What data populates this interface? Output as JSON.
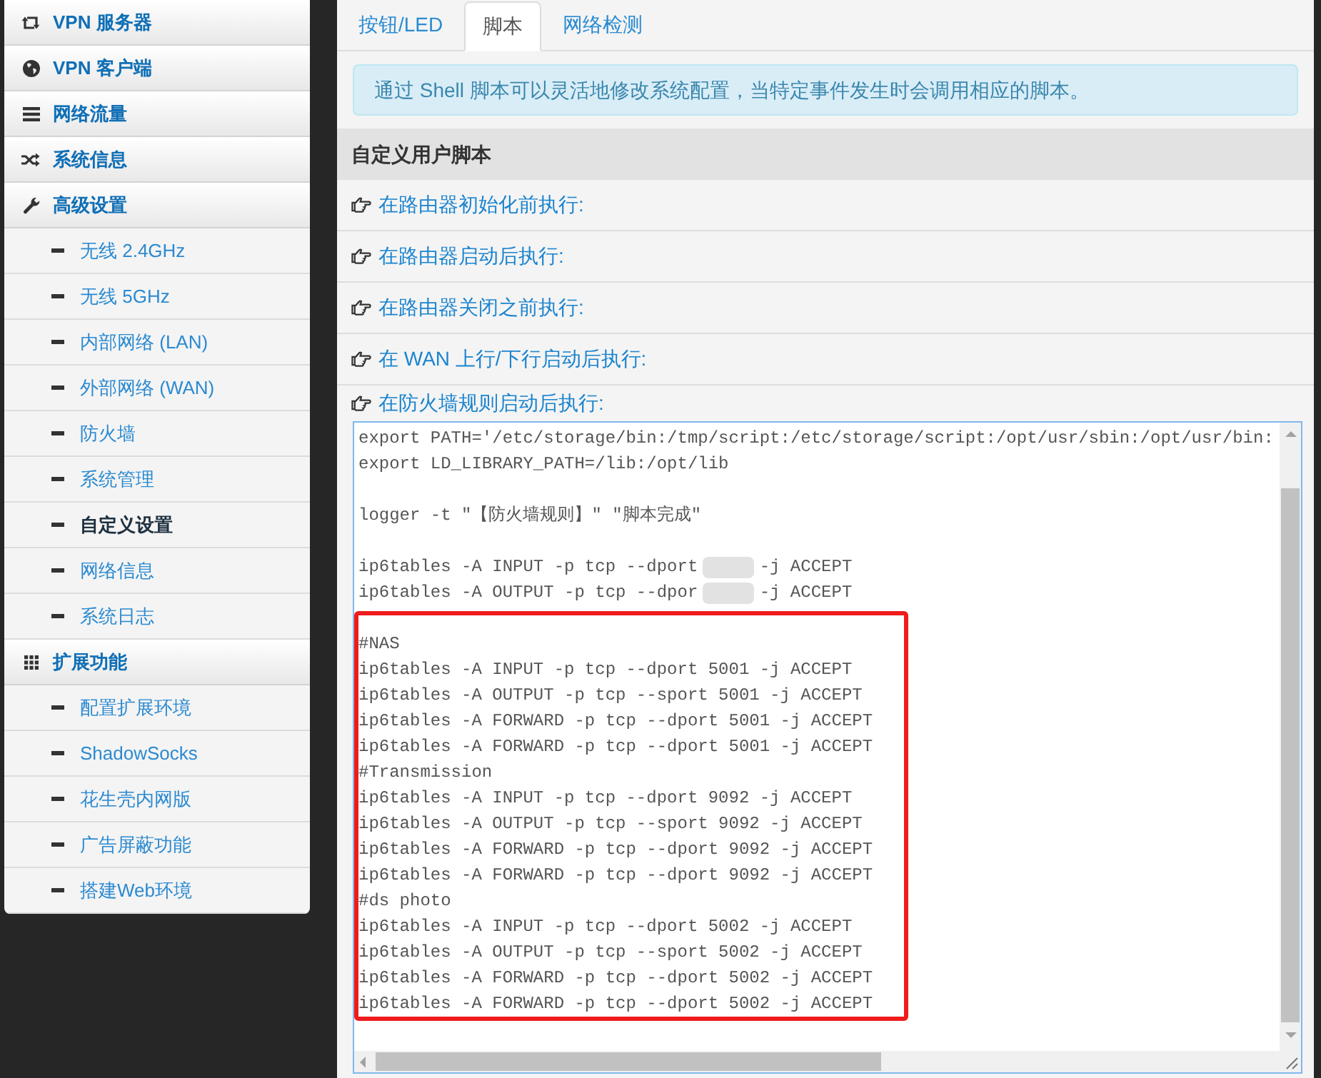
{
  "sidebar": [
    {
      "label": "VPN 服务器"
    },
    {
      "label": "VPN 客户端"
    },
    {
      "label": "网络流量"
    },
    {
      "label": "系统信息"
    },
    {
      "label": "高级设置",
      "children": [
        {
          "label": "无线 2.4GHz",
          "selected": false
        },
        {
          "label": "无线 5GHz",
          "selected": false
        },
        {
          "label": "内部网络 (LAN)",
          "selected": false
        },
        {
          "label": "外部网络 (WAN)",
          "selected": false
        },
        {
          "label": "防火墙",
          "selected": false
        },
        {
          "label": "系统管理",
          "selected": false
        },
        {
          "label": "自定义设置",
          "selected": true
        },
        {
          "label": "网络信息",
          "selected": false
        },
        {
          "label": "系统日志",
          "selected": false
        }
      ]
    },
    {
      "label": "扩展功能",
      "children": [
        {
          "label": "配置扩展环境",
          "selected": false
        },
        {
          "label": "ShadowSocks",
          "selected": false
        },
        {
          "label": "花生壳内网版",
          "selected": false
        },
        {
          "label": "广告屏蔽功能",
          "selected": false
        },
        {
          "label": "搭建Web环境",
          "selected": false
        }
      ]
    }
  ],
  "tabs": [
    {
      "label": "按钮/LED",
      "selected": false
    },
    {
      "label": "脚本",
      "selected": true
    },
    {
      "label": "网络检测",
      "selected": false
    }
  ],
  "alert": {
    "text": "通过 Shell 脚本可以灵活地修改系统配置，当特定事件发生时会调用相应的脚本。"
  },
  "section": {
    "title": "自定义用户脚本",
    "scripts": [
      {
        "label": "在路由器初始化前执行:",
        "expanded": false
      },
      {
        "label": "在路由器启动后执行:",
        "expanded": false
      },
      {
        "label": "在路由器关闭之前执行:",
        "expanded": false
      },
      {
        "label": "在 WAN 上行/下行启动后执行:",
        "expanded": false
      },
      {
        "label": "在防火墙规则启动后执行:",
        "expanded": true,
        "editor": {
          "lines": [
            {
              "kind": "code",
              "text": "export PATH='/etc/storage/bin:/tmp/script:/etc/storage/script:/opt/usr/sbin:/opt/usr/bin:"
            },
            {
              "kind": "code",
              "text": "export LD_LIBRARY_PATH=/lib:/opt/lib"
            },
            {
              "kind": "blank"
            },
            {
              "kind": "code",
              "text": "logger -t \"【防火墙规则】\" \"脚本完成\""
            },
            {
              "kind": "blank"
            },
            {
              "kind": "redacted",
              "before": "ip6tables -A INPUT -p tcp --dport",
              "after": "-j ACCEPT"
            },
            {
              "kind": "redacted",
              "before": "ip6tables -A OUTPUT -p tcp --dpor",
              "after": "-j ACCEPT"
            }
          ],
          "highlighted_lines": [
            {
              "kind": "code",
              "text": "#NAS"
            },
            {
              "kind": "code",
              "text": "ip6tables -A INPUT -p tcp --dport 5001 -j ACCEPT"
            },
            {
              "kind": "code",
              "text": "ip6tables -A OUTPUT -p tcp --sport 5001 -j ACCEPT"
            },
            {
              "kind": "code",
              "text": "ip6tables -A FORWARD -p tcp --dport 5001 -j ACCEPT"
            },
            {
              "kind": "code",
              "text": "ip6tables -A FORWARD -p tcp --dport 5001 -j ACCEPT"
            },
            {
              "kind": "code",
              "text": "#Transmission"
            },
            {
              "kind": "code",
              "text": "ip6tables -A INPUT -p tcp --dport 9092 -j ACCEPT"
            },
            {
              "kind": "code",
              "text": "ip6tables -A OUTPUT -p tcp --sport 9092 -j ACCEPT"
            },
            {
              "kind": "code",
              "text": "ip6tables -A FORWARD -p tcp --dport 9092 -j ACCEPT"
            },
            {
              "kind": "code",
              "text": "ip6tables -A FORWARD -p tcp --dport 9092 -j ACCEPT"
            },
            {
              "kind": "code",
              "text": "#ds photo"
            },
            {
              "kind": "code",
              "text": "ip6tables -A INPUT -p tcp --dport 5002 -j ACCEPT"
            },
            {
              "kind": "code",
              "text": "ip6tables -A OUTPUT -p tcp --sport 5002 -j ACCEPT"
            },
            {
              "kind": "code",
              "text": "ip6tables -A FORWARD -p tcp --dport 5002 -j ACCEPT"
            },
            {
              "kind": "code",
              "text": "ip6tables -A FORWARD -p tcp --dport 5002 -j ACCEPT"
            }
          ]
        }
      }
    ]
  }
}
